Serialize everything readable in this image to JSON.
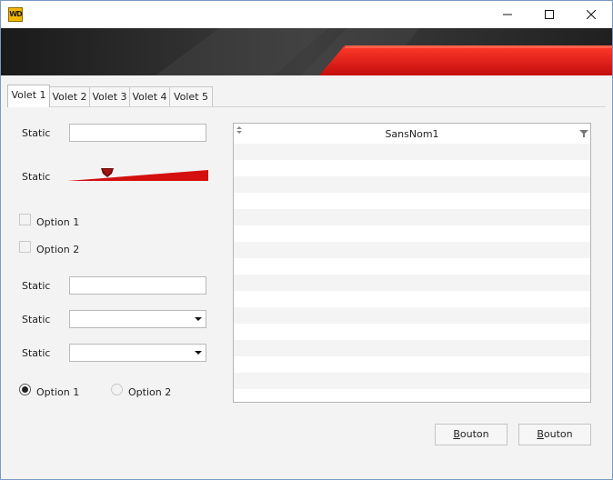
{
  "window": {
    "app_icon_text": "WD",
    "controls": [
      "minimize",
      "maximize",
      "close"
    ]
  },
  "tabs": [
    {
      "label": "Volet 1",
      "active": true
    },
    {
      "label": "Volet 2",
      "active": false
    },
    {
      "label": "Volet 3",
      "active": false
    },
    {
      "label": "Volet 4",
      "active": false
    },
    {
      "label": "Volet 5",
      "active": false
    }
  ],
  "form": {
    "static_1": "Static",
    "static_slider": "Static",
    "checkbox_1": "Option 1",
    "checkbox_2": "Option 2",
    "static_2": "Static",
    "static_3": "Static",
    "static_4": "Static",
    "radio_1": "Option 1",
    "radio_2": "Option 2"
  },
  "table": {
    "column_header": "SansNom1",
    "row_count": 15
  },
  "buttons": {
    "button_1": {
      "label_rest": "outon",
      "underlined": "B"
    },
    "button_2": {
      "label_rest": "outon",
      "underlined": "B"
    }
  },
  "colors": {
    "accent_red": "#e01a1a",
    "banner_dark": "#2a2a2a",
    "row_alt": "#f4f4f4"
  }
}
